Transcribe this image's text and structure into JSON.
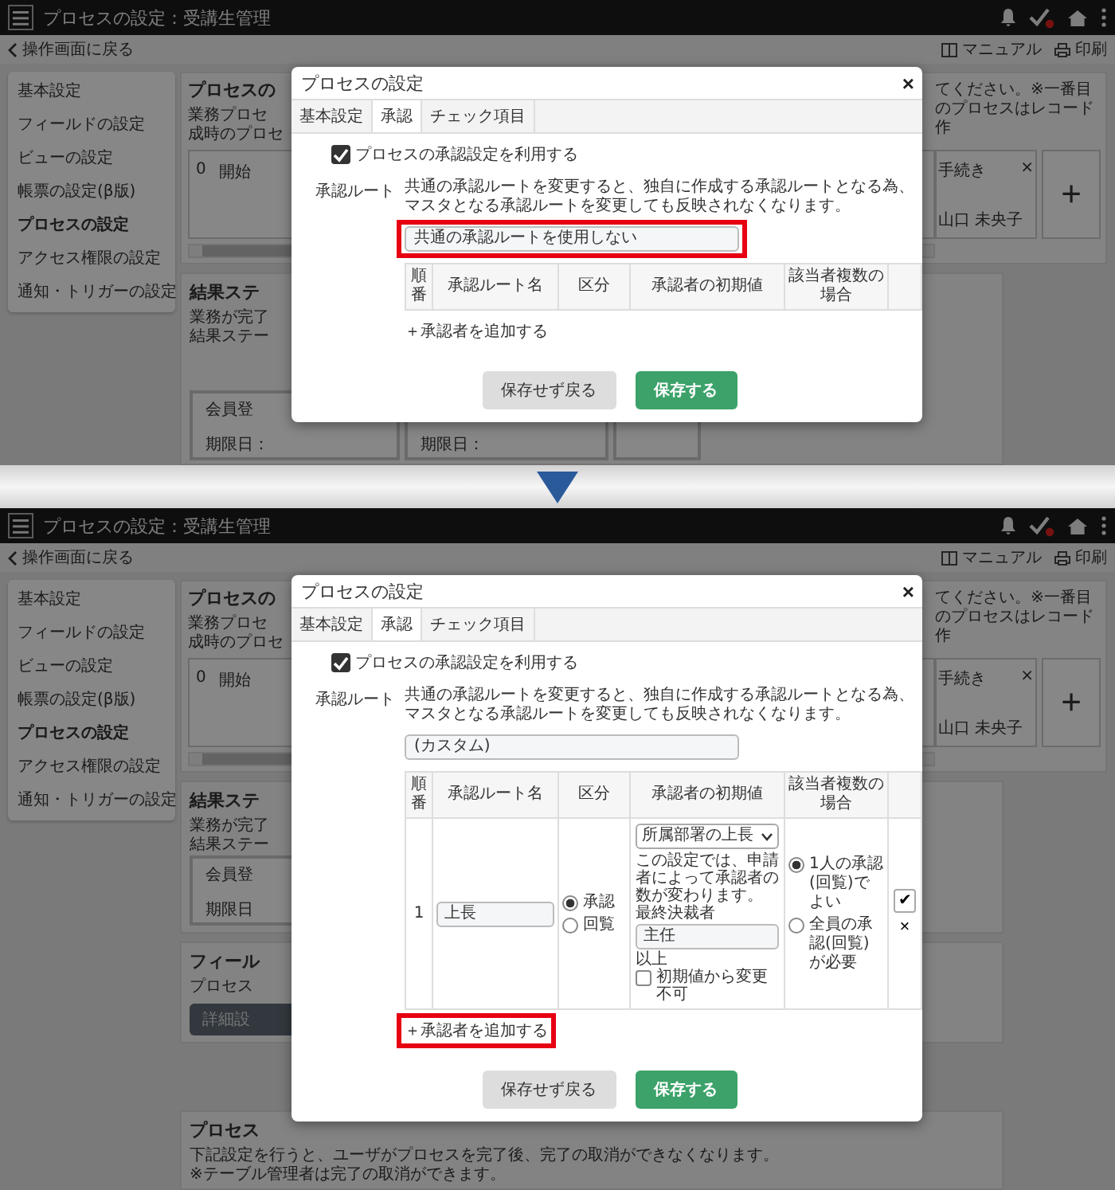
{
  "panels": [
    {
      "header": {
        "title": "プロセスの設定：受講生管理"
      },
      "subbar": {
        "back": "操作画面に戻る",
        "manual": "マニュアル",
        "print": "印刷"
      },
      "sidebar": [
        {
          "label": "基本設定",
          "selected": false
        },
        {
          "label": "フィールドの設定",
          "selected": false
        },
        {
          "label": "ビューの設定",
          "selected": false
        },
        {
          "label": "帳票の設定(β版)",
          "selected": false
        },
        {
          "label": "プロセスの設定",
          "selected": true
        },
        {
          "label": "アクセス権限の設定",
          "selected": false
        },
        {
          "label": "通知・トリガーの設定",
          "selected": false
        }
      ],
      "background": {
        "title": "プロセスの",
        "lines": [
          "業務プロセ",
          "成時のプロセ"
        ],
        "right_note": "てください。※一番目のプロセスはレコード作",
        "first_card": {
          "number": "0",
          "name": "開始"
        },
        "last_card": {
          "name": "手続き",
          "close": "×",
          "user": "山口 未央子"
        },
        "add_card": "+",
        "sections": [
          {
            "kind": "result",
            "title": "結果ステ",
            "lines": [
              "業務が完了",
              "結果ステー"
            ],
            "cards": [
              {
                "kind": "status",
                "name": "会員登",
                "due": "期限日："
              },
              {
                "kind": "status",
                "due": "期限日："
              },
              {
                "kind": "status"
              }
            ]
          }
        ]
      },
      "dialog": {
        "title": "プロセスの設定",
        "close": "×",
        "tabs": [
          {
            "label": "基本設定",
            "selected": false
          },
          {
            "label": "承認",
            "selected": true
          },
          {
            "label": "チェック項目",
            "selected": false
          }
        ],
        "use_approval": {
          "label": "プロセスの承認設定を利用する",
          "checked": true
        },
        "route_label": "承認ルート",
        "route_note": "共通の承認ルートを変更すると、独自に作成する承認ルートとなる為、マスタとなる承認ルートを変更しても反映されなくなります。",
        "route_field": {
          "value": "共通の承認ルートを使用しない",
          "highlight": true
        },
        "table": {
          "columns": [
            "順番",
            "承認ルート名",
            "区分",
            "承認者の初期値",
            "該当者複数の場合"
          ]
        },
        "add_link": {
          "label": "＋承認者を追加する",
          "highlight": false
        },
        "buttons": [
          {
            "label": "保存せず戻る",
            "kind": "secondary"
          },
          {
            "label": "保存する",
            "kind": "primary"
          }
        ]
      }
    },
    {
      "header": {
        "title": "プロセスの設定：受講生管理"
      },
      "subbar": {
        "back": "操作画面に戻る",
        "manual": "マニュアル",
        "print": "印刷"
      },
      "sidebar": [
        {
          "label": "基本設定",
          "selected": false
        },
        {
          "label": "フィールドの設定",
          "selected": false
        },
        {
          "label": "ビューの設定",
          "selected": false
        },
        {
          "label": "帳票の設定(β版)",
          "selected": false
        },
        {
          "label": "プロセスの設定",
          "selected": true
        },
        {
          "label": "アクセス権限の設定",
          "selected": false
        },
        {
          "label": "通知・トリガーの設定",
          "selected": false
        }
      ],
      "background": {
        "title": "プロセスの",
        "lines": [
          "業務プロセ",
          "成時のプロセ"
        ],
        "right_note": "てください。※一番目のプロセスはレコード作",
        "first_card": {
          "number": "0",
          "name": "開始"
        },
        "last_card": {
          "name": "手続き",
          "close": "×",
          "user": "山口 未央子"
        },
        "add_card": "+",
        "sections": [
          {
            "kind": "result",
            "title": "結果ステ",
            "lines": [
              "業務が完了",
              "結果ステー"
            ],
            "cards": [
              {
                "kind": "status",
                "name": "会員登",
                "due": "期限日"
              }
            ]
          },
          {
            "kind": "field",
            "title": "フィール",
            "lines": [
              "プロセス"
            ],
            "button": "詳細設"
          },
          {
            "kind": "lock",
            "title": "プロセス",
            "lines": [
              "下記設定を行うと、ユーザがプロセスを完了後、完了の取消ができなくなります。",
              "※テーブル管理者は完了の取消ができます。"
            ]
          }
        ]
      },
      "dialog": {
        "title": "プロセスの設定",
        "close": "×",
        "tabs": [
          {
            "label": "基本設定",
            "selected": false
          },
          {
            "label": "承認",
            "selected": true
          },
          {
            "label": "チェック項目",
            "selected": false
          }
        ],
        "use_approval": {
          "label": "プロセスの承認設定を利用する",
          "checked": true
        },
        "route_label": "承認ルート",
        "route_note": "共通の承認ルートを変更すると、独自に作成する承認ルートとなる為、マスタとなる承認ルートを変更しても反映されなくなります。",
        "route_field": {
          "value": "(カスタム)",
          "highlight": false
        },
        "table": {
          "columns": [
            "順番",
            "承認ルート名",
            "区分",
            "承認者の初期値",
            "該当者複数の場合"
          ],
          "rows": [
            {
              "order": "1",
              "name": "上長",
              "types": [
                {
                  "label": "承認",
                  "selected": true
                },
                {
                  "label": "回覧",
                  "selected": false
                }
              ],
              "approver": {
                "select": "所属部署の上長",
                "note": "この設定では、申請者によって承認者の数が変わります。",
                "final_label": "最終決裁者",
                "final_value": "主任",
                "final_suffix": "以上",
                "lock": {
                  "label": "初期値から変更不可",
                  "checked": false
                }
              },
              "multiple": [
                {
                  "label": "1人の承認(回覧)でよい",
                  "selected": true
                },
                {
                  "label": "全員の承認(回覧)が必要",
                  "selected": false
                }
              ],
              "confirm": "✔",
              "remove": "×"
            }
          ]
        },
        "add_link": {
          "label": "＋承認者を追加する",
          "highlight": true
        },
        "buttons": [
          {
            "label": "保存せず戻る",
            "kind": "secondary"
          },
          {
            "label": "保存する",
            "kind": "primary"
          }
        ]
      }
    }
  ]
}
